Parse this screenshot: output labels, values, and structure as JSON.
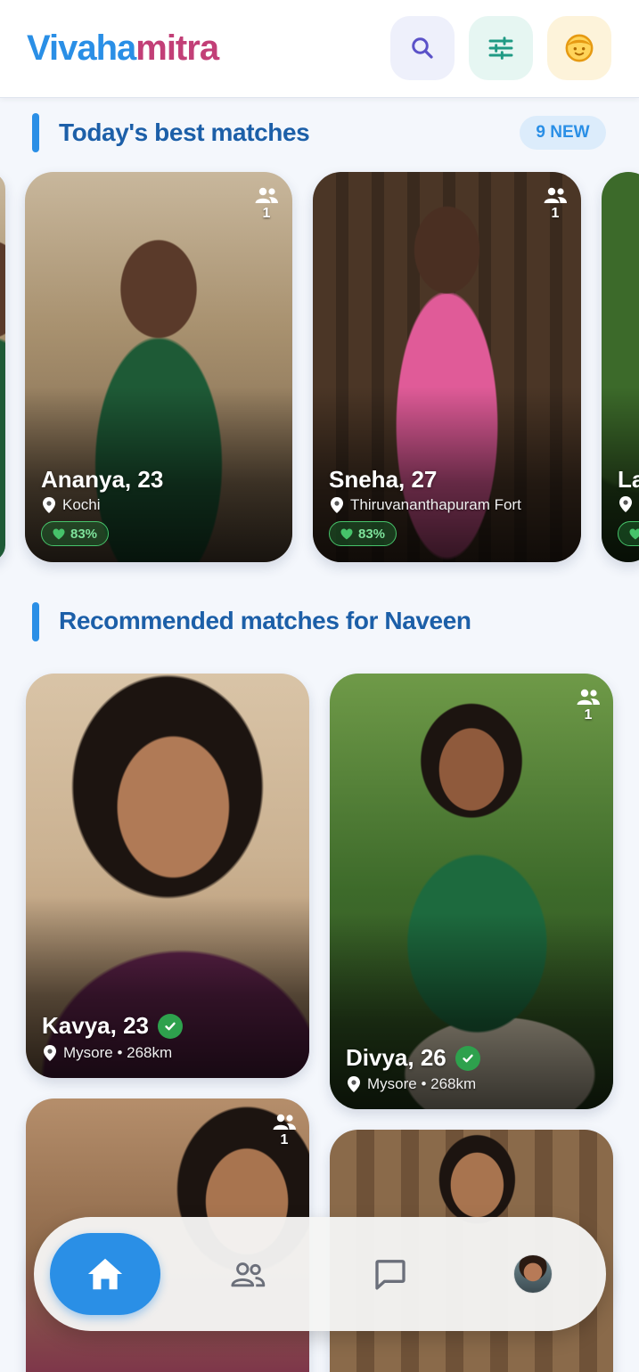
{
  "header": {
    "logo_part1": "Vivaha",
    "logo_part2": "mitra",
    "buttons": [
      "search-icon",
      "filter-icon",
      "profile-face-icon"
    ]
  },
  "best_matches": {
    "title": "Today's best matches",
    "new_badge": "9 NEW",
    "cards": [
      {
        "name": "Ananya, 23",
        "location": "Kochi",
        "match": "83%",
        "group_count": "1"
      },
      {
        "name": "Sneha, 27",
        "location": "Thiruvananthapuram Fort",
        "match": "83%",
        "group_count": "1"
      },
      {
        "name": "La",
        "location": "",
        "match": ""
      }
    ]
  },
  "recommended": {
    "title": "Recommended matches for Naveen",
    "cards": [
      {
        "name": "Kavya, 23",
        "location": "Mysore • 268km",
        "verified": true
      },
      {
        "name": "Divya, 26",
        "location": "Mysore • 268km",
        "verified": true,
        "group_count": "1"
      },
      {
        "name": "",
        "group_count": "1"
      },
      {
        "name": ""
      }
    ]
  },
  "bottom_nav": {
    "items": [
      "home-icon",
      "people-icon",
      "chat-icon",
      "profile-avatar"
    ],
    "active": "home-icon"
  },
  "colors": {
    "brand_blue": "#2a8fe6",
    "brand_pink": "#c23f77",
    "title_blue": "#1c5fa8",
    "match_green": "#46c36a",
    "verified_green": "#2ea14d"
  }
}
